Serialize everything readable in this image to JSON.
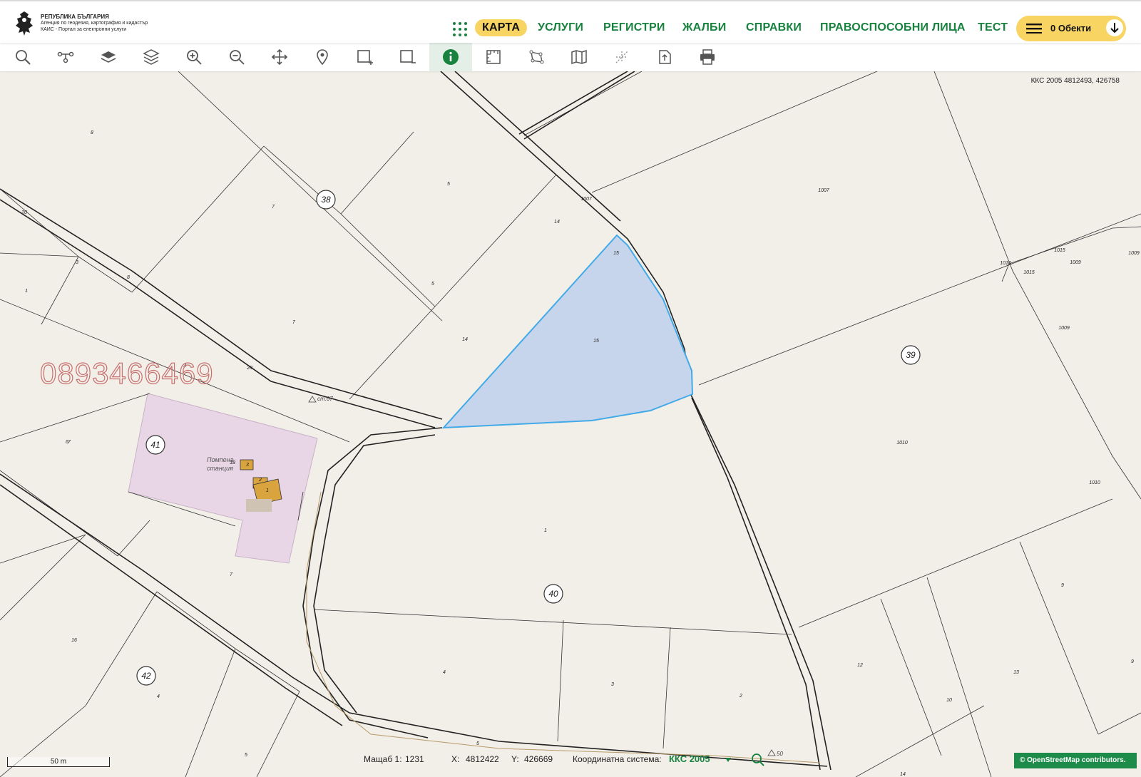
{
  "header": {
    "logo_line1": "РЕПУБЛИКА БЪЛГАРИЯ",
    "logo_line2": "Агенция по геодезия, картография и кадастър",
    "logo_line3": "КАИС - Портал за електронни услуги",
    "nav": [
      "КАРТА",
      "УСЛУГИ",
      "РЕГИСТРИ",
      "ЖАЛБИ",
      "СПРАВКИ",
      "ПРАВОСПОСОБНИ ЛИЦА",
      "ТЕСТ"
    ],
    "objects_label": "0 Обекти"
  },
  "toolbar": {
    "tools": [
      "search-icon",
      "route-icon",
      "layer-icon",
      "layers-icon",
      "zoom-in-icon",
      "zoom-out-icon",
      "pan-icon",
      "location-pin-icon",
      "select-add-icon",
      "select-remove-icon",
      "info-icon",
      "measure-icon",
      "polygon-icon",
      "map-icon",
      "crosshair-icon",
      "export-icon",
      "print-icon"
    ],
    "active_tool": "info-icon"
  },
  "map": {
    "coord_readout": "ККС 2005 4812493, 426758",
    "watermark": "0893466469",
    "landmark_label_1": "Помпена",
    "landmark_label_2": "станция",
    "elevation_1": "ст.67",
    "elevation_2": "50",
    "district_labels": [
      "38",
      "39",
      "40",
      "41",
      "42"
    ],
    "parcel_labels": [
      "8",
      "7",
      "5",
      "14",
      "1007",
      "1007",
      "15",
      "15",
      "7",
      "5",
      "14",
      "20",
      "3",
      "8",
      "1",
      "7",
      "3",
      "20",
      "6",
      "1010",
      "1015",
      "1015",
      "1009",
      "1009",
      "1009",
      "1010",
      "1010",
      "1",
      "7",
      "16",
      "4",
      "4",
      "3",
      "2",
      "5",
      "5",
      "12",
      "13",
      "10",
      "9",
      "9",
      "14",
      "1",
      "2",
      "3",
      "18"
    ],
    "colors": {
      "background": "#f2efe9",
      "selected_fill": "#c7d5ec",
      "selected_stroke": "#43aae8",
      "facility_fill": "#e8d6e6",
      "building_fill": "#d9a43d",
      "accent_green": "#17833e",
      "accent_yellow": "#f8d462"
    }
  },
  "status": {
    "scale_label": "Мащаб 1:",
    "scale_value": "1231",
    "x_label": "X:",
    "x_value": "4812422",
    "y_label": "Y:",
    "y_value": "426669",
    "crs_label": "Координатна система:",
    "crs_value": "ККС 2005"
  },
  "scalebar_label": "50 m",
  "attribution": "© OpenStreetMap contributors."
}
